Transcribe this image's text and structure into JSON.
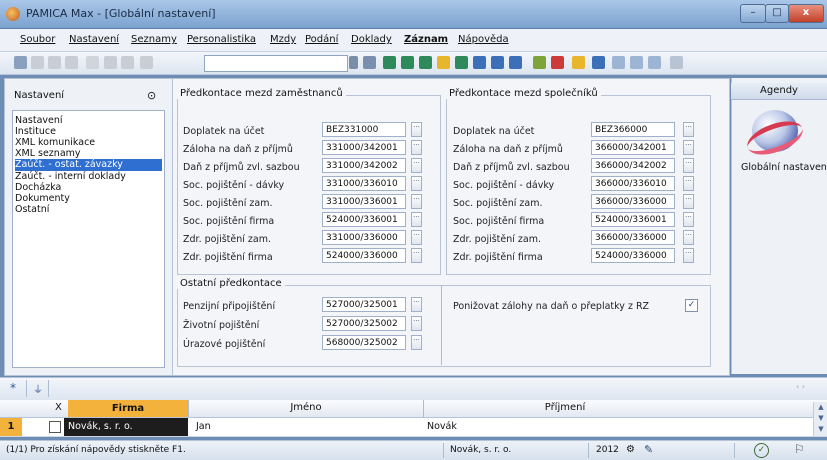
{
  "window": {
    "title": "PAMICA Max - [Globální nastavení]",
    "minimize": "–",
    "maximize": "□",
    "close": "x"
  },
  "menu": [
    {
      "label": "Soubor"
    },
    {
      "label": "Nastavení"
    },
    {
      "label": "Seznamy"
    },
    {
      "label": "Personalistika"
    },
    {
      "label": "Mzdy"
    },
    {
      "label": "Podání"
    },
    {
      "label": "Doklady"
    },
    {
      "label": "Záznam"
    },
    {
      "label": "Nápověda"
    }
  ],
  "left": {
    "title": "Nastavení",
    "pin_icon": "pin-icon",
    "items": [
      {
        "label": "Nastavení"
      },
      {
        "label": "Instituce"
      },
      {
        "label": "XML komunikace"
      },
      {
        "label": "XML seznamy"
      },
      {
        "label": "Zaúčt. - ostat. závazky"
      },
      {
        "label": "Zaúčt. - interní doklady"
      },
      {
        "label": "Docházka"
      },
      {
        "label": "Dokumenty"
      },
      {
        "label": "Ostatní"
      }
    ],
    "selected_index": 4
  },
  "employees": {
    "title": "Předkontace mezd zaměstnanců",
    "rows": [
      {
        "label": "Doplatek na účet",
        "value": "BEZ331000"
      },
      {
        "label": "Záloha na daň z příjmů",
        "value": "331000/342001"
      },
      {
        "label": "Daň z příjmů zvl. sazbou",
        "value": "331000/342002"
      },
      {
        "label": "Soc. pojištění - dávky",
        "value": "331000/336010"
      },
      {
        "label": "Soc. pojištění zam.",
        "value": "331000/336001"
      },
      {
        "label": "Soc. pojištění firma",
        "value": "524000/336001"
      },
      {
        "label": "Zdr. pojištění zam.",
        "value": "331000/336000"
      },
      {
        "label": "Zdr. pojištění firma",
        "value": "524000/336000"
      }
    ]
  },
  "partners": {
    "title": "Předkontace mezd společníků",
    "rows": [
      {
        "label": "Doplatek na účet",
        "value": "BEZ366000"
      },
      {
        "label": "Záloha na daň z příjmů",
        "value": "366000/342001"
      },
      {
        "label": "Daň z příjmů zvl. sazbou",
        "value": "366000/342002"
      },
      {
        "label": "Soc. pojištění - dávky",
        "value": "366000/336010"
      },
      {
        "label": "Soc. pojištění zam.",
        "value": "366000/336000"
      },
      {
        "label": "Soc. pojištění firma",
        "value": "524000/336001"
      },
      {
        "label": "Zdr. pojištění zam.",
        "value": "366000/336000"
      },
      {
        "label": "Zdr. pojištění firma",
        "value": "524000/336000"
      }
    ]
  },
  "other": {
    "title": "Ostatní předkontace",
    "rows": [
      {
        "label": "Penzijní připojištění",
        "value": "527000/325001"
      },
      {
        "label": "Životní pojištění",
        "value": "527000/325002"
      },
      {
        "label": "Úrazové pojištění",
        "value": "568000/325002"
      }
    ],
    "option": {
      "label": "Ponižovat zálohy na daň o přeplatky z RZ",
      "checked_mark": "✓"
    }
  },
  "right": {
    "header": "Agendy",
    "item": "Globální nastavení"
  },
  "grid": {
    "headers": {
      "x": "X",
      "firma": "Firma",
      "jmeno": "Jméno",
      "prijmeni": "Příjmení"
    },
    "row": {
      "index": "1",
      "firma": "Novák, s. r. o.",
      "jmeno": "Jan",
      "prijmeni": "Novák"
    }
  },
  "status": {
    "hint": "(1/1) Pro získání nápovědy stiskněte F1.",
    "company": "Novák, s. r. o.",
    "year": "2012"
  },
  "colors": {
    "accent": "#2f6fd1",
    "firma_header": "#f2b23c",
    "selected_row": "#1d1d1d"
  }
}
